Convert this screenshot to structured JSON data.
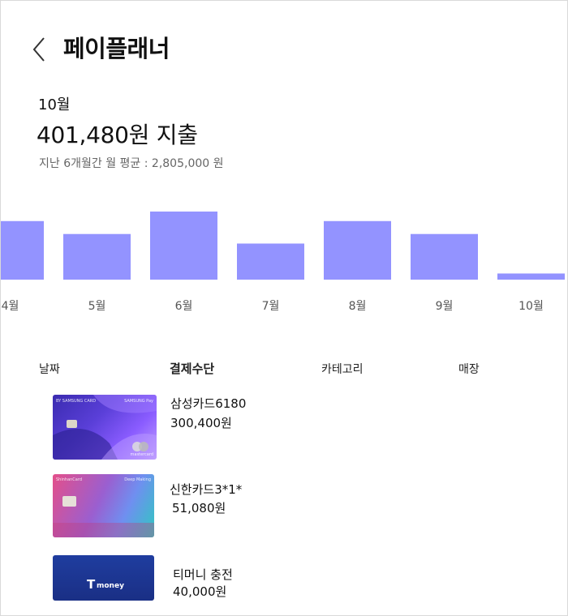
{
  "header": {
    "title": "페이플래너",
    "back_icon": "chevron-left-icon"
  },
  "summary": {
    "month": "10월",
    "total": "401,480원 지출",
    "average": "지난 6개월간 월 평균 : 2,805,000 원"
  },
  "chart_data": {
    "type": "bar",
    "categories": [
      "4월",
      "5월",
      "6월",
      "7월",
      "8월",
      "9월",
      "10월"
    ],
    "relative_values": [
      0.86,
      0.67,
      1.0,
      0.53,
      0.86,
      0.67,
      0.09
    ],
    "tick_labels_shown": [
      "월",
      "5월",
      "6월",
      "7월",
      "8월",
      "9월",
      "10월"
    ],
    "bar_color": "#9393ff",
    "grid": false
  },
  "tabs": [
    {
      "label": "날짜",
      "active": false
    },
    {
      "label": "결제수단",
      "active": true
    },
    {
      "label": "카테고리",
      "active": false
    },
    {
      "label": "매장",
      "active": false
    }
  ],
  "payments": [
    {
      "name": "삼성카드6180",
      "amount": "300,400원",
      "card": {
        "top_left": "BY SAMSUNG CARD",
        "top_right": "SAMSUNG Pay",
        "bottom": "mastercard",
        "colors": [
          "#3a2bb0",
          "#8a5cff",
          "#c4a4ff"
        ]
      }
    },
    {
      "name": "신한카드3*1*",
      "amount": "51,080원",
      "card": {
        "top_left": "ShinhanCard",
        "top_right": "Deep Making",
        "colors": [
          "#2fc8c0",
          "#7c6cf2",
          "#e44f8a"
        ]
      }
    },
    {
      "name": "티머니 충전",
      "amount": "40,000원",
      "card": {
        "logo_text": "money",
        "logo_mark": "T",
        "colors": [
          "#1e3a9a",
          "#1a2f85"
        ]
      }
    }
  ]
}
